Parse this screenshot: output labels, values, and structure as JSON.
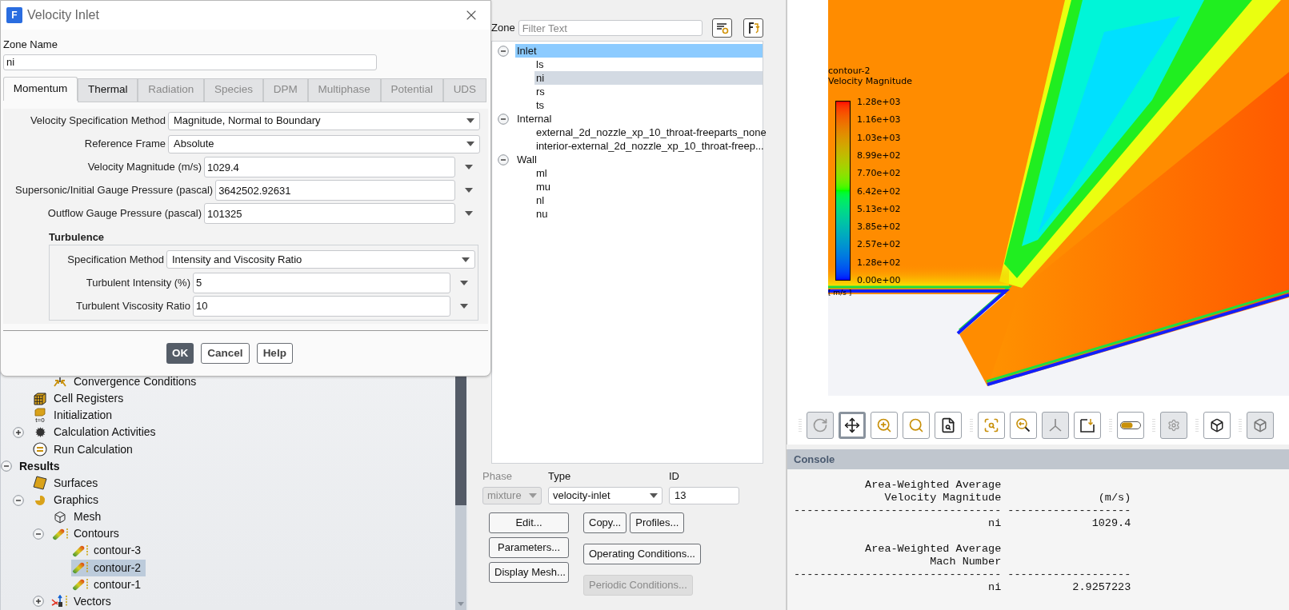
{
  "dialog": {
    "logo": "F",
    "title": "Velocity Inlet",
    "zone_name": {
      "label": "Zone Name",
      "value": "ni"
    },
    "tabs": [
      {
        "label": "Momentum",
        "selected": true,
        "disabled": false
      },
      {
        "label": "Thermal",
        "selected": false,
        "disabled": false
      },
      {
        "label": "Radiation",
        "selected": false,
        "disabled": true
      },
      {
        "label": "Species",
        "selected": false,
        "disabled": true
      },
      {
        "label": "DPM",
        "selected": false,
        "disabled": true
      },
      {
        "label": "Multiphase",
        "selected": false,
        "disabled": true
      },
      {
        "label": "Potential",
        "selected": false,
        "disabled": true
      },
      {
        "label": "UDS",
        "selected": false,
        "disabled": true
      }
    ],
    "fields": [
      {
        "kind": "dropdown",
        "label": "Velocity Specification Method",
        "value": "Magnitude, Normal to Boundary"
      },
      {
        "kind": "dropdown",
        "label": "Reference Frame",
        "value": "Absolute"
      },
      {
        "kind": "input",
        "label": "Velocity Magnitude (m/s)",
        "value": "1029.4"
      },
      {
        "kind": "input",
        "label": "Supersonic/Initial Gauge Pressure (pascal)",
        "value": "3642502.92631"
      },
      {
        "kind": "input",
        "label": "Outflow Gauge Pressure (pascal)",
        "value": "101325"
      }
    ],
    "turbulence": {
      "title": "Turbulence",
      "fields": [
        {
          "kind": "dropdown",
          "label": "Specification Method",
          "value": "Intensity and Viscosity Ratio"
        },
        {
          "kind": "input",
          "label": "Turbulent Intensity (%)",
          "value": "5"
        },
        {
          "kind": "input",
          "label": "Turbulent Viscosity Ratio",
          "value": "10"
        }
      ]
    },
    "buttons": [
      {
        "label": "OK",
        "primary": true
      },
      {
        "label": "Cancel",
        "primary": false
      },
      {
        "label": "Help",
        "primary": false
      }
    ]
  },
  "outline_tree": [
    {
      "children": [
        {
          "children": [
            {
              "label": "Convergence Conditions",
              "kind": "monitor",
              "selected": false
            }
          ]
        },
        {
          "label": "Cell Registers",
          "kind": "registers",
          "selected": false
        },
        {
          "label": "Initialization",
          "kind": "init",
          "badge": "t=0",
          "selected": false
        },
        {
          "label": "Calculation Activities",
          "kind": "activities",
          "expanded": false,
          "selected": false
        },
        {
          "label": "Run Calculation",
          "kind": "run",
          "selected": false
        }
      ]
    },
    {
      "label": "Results",
      "kind": "group",
      "expanded": true,
      "selected": false,
      "children": [
        {
          "label": "Surfaces",
          "kind": "surfaces",
          "selected": false
        },
        {
          "label": "Graphics",
          "kind": "graphics",
          "expanded": true,
          "selected": false,
          "children": [
            {
              "label": "Mesh",
              "kind": "mesh",
              "selected": false
            },
            {
              "label": "Contours",
              "kind": "contours",
              "expanded": true,
              "selected": false,
              "children": [
                {
                  "label": "contour-3",
                  "kind": "contour",
                  "selected": false
                },
                {
                  "label": "contour-2",
                  "kind": "contour",
                  "selected": true
                },
                {
                  "label": "contour-1",
                  "kind": "contour",
                  "selected": false
                }
              ]
            },
            {
              "label": "Vectors",
              "kind": "vectors",
              "expanded": false,
              "selected": false
            }
          ]
        }
      ]
    }
  ],
  "zone_panel": {
    "label": "Zone",
    "filter": {
      "placeholder": "Filter Text"
    },
    "groups": [
      {
        "label": "Inlet",
        "expanded": true,
        "selected": true,
        "children": [
          {
            "label": "ls",
            "selected": false
          },
          {
            "label": "ni",
            "selected": true
          },
          {
            "label": "rs",
            "selected": false
          },
          {
            "label": "ts",
            "selected": false
          }
        ]
      },
      {
        "label": "Internal",
        "expanded": true,
        "selected": false,
        "children": [
          {
            "label": "external_2d_nozzle_xp_10_throat-freeparts_none",
            "selected": false
          },
          {
            "label": "interior-external_2d_nozzle_xp_10_throat-freep...",
            "selected": false
          }
        ]
      },
      {
        "label": "Wall",
        "expanded": true,
        "selected": false,
        "children": [
          {
            "label": "ml",
            "selected": false
          },
          {
            "label": "mu",
            "selected": false
          },
          {
            "label": "nl",
            "selected": false
          },
          {
            "label": "nu",
            "selected": false
          }
        ]
      }
    ],
    "phase": {
      "label": "Phase",
      "value": "mixture",
      "disabled": true
    },
    "type": {
      "label": "Type",
      "value": "velocity-inlet"
    },
    "id": {
      "label": "ID",
      "value": "13"
    },
    "left_buttons": [
      {
        "label": "Edit...",
        "disabled": false
      },
      {
        "label": "Parameters...",
        "disabled": false
      },
      {
        "label": "Display Mesh...",
        "disabled": false
      }
    ],
    "right_button_rows": [
      {
        "buttons": [
          {
            "label": "Copy...",
            "disabled": false
          },
          {
            "label": "Profiles...",
            "disabled": false
          }
        ]
      },
      {
        "buttons": [
          {
            "label": "Operating Conditions...",
            "disabled": false
          }
        ]
      },
      {
        "buttons": [
          {
            "label": "Periodic Conditions...",
            "disabled": true
          }
        ]
      }
    ]
  },
  "graphics": {
    "legend": {
      "title": "contour-2",
      "quantity": "Velocity Magnitude",
      "ticks": [
        "1.28e+03",
        "1.16e+03",
        "1.03e+03",
        "8.99e+02",
        "7.70e+02",
        "6.42e+02",
        "5.13e+02",
        "3.85e+02",
        "2.57e+02",
        "1.28e+02",
        "0.00e+00"
      ],
      "units": "[ m/s ]"
    }
  },
  "toolbar": [
    {
      "items": [
        {
          "kind": "rotate",
          "disabled": true,
          "selected": false
        },
        {
          "kind": "pan",
          "disabled": false,
          "selected": true
        },
        {
          "kind": "zoom-in-out",
          "disabled": false,
          "selected": false
        },
        {
          "kind": "zoom",
          "disabled": false,
          "selected": false
        },
        {
          "kind": "zoom-report",
          "disabled": false,
          "selected": false
        }
      ]
    },
    {
      "items": [
        {
          "kind": "zoom-box",
          "disabled": false,
          "selected": false
        },
        {
          "kind": "zoom-back",
          "disabled": false,
          "selected": false
        },
        {
          "kind": "axes",
          "disabled": true,
          "selected": false
        },
        {
          "kind": "snapshot",
          "disabled": false,
          "selected": false
        }
      ]
    },
    {
      "items": [
        {
          "kind": "colormap",
          "disabled": false,
          "selected": false
        }
      ]
    },
    {
      "items": [
        {
          "kind": "tweaks",
          "disabled": true,
          "selected": false
        }
      ]
    },
    {
      "items": [
        {
          "kind": "iso-view",
          "disabled": false,
          "selected": false
        }
      ]
    },
    {
      "items": [
        {
          "kind": "box-view",
          "disabled": true,
          "selected": false
        }
      ]
    }
  ],
  "console": {
    "title": "Console",
    "blocks": [
      {
        "lines": [
          "           Area-Weighted Average",
          "              Velocity Magnitude               (m/s)",
          "-------------------------------- -------------------",
          "                              ni              1029.4"
        ]
      },
      {
        "lines": [
          "           Area-Weighted Average",
          "                     Mach Number",
          "-------------------------------- -------------------",
          "                              ni           2.9257223"
        ]
      }
    ]
  }
}
